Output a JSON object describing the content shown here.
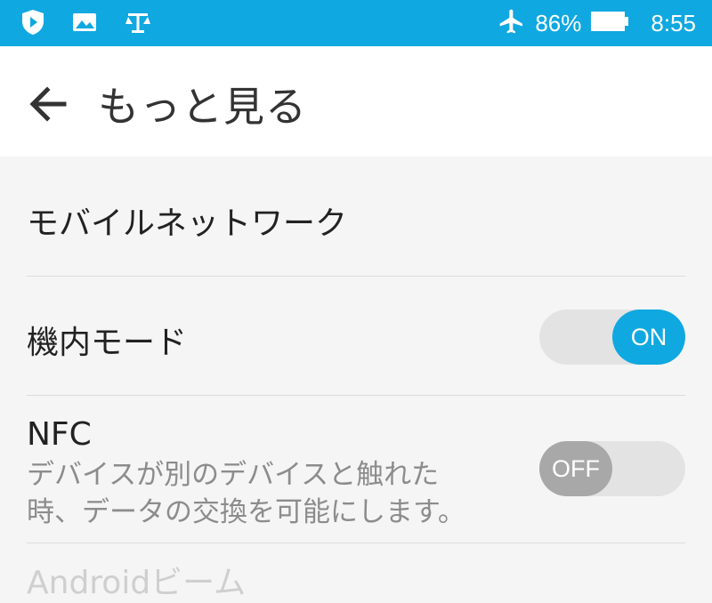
{
  "status_bar": {
    "battery_percent": "86%",
    "time": "8:55",
    "icons": [
      "play-shield-icon",
      "image-icon",
      "scale-icon",
      "airplane-icon",
      "battery-icon"
    ]
  },
  "header": {
    "title": "もっと見る"
  },
  "items": [
    {
      "title": "モバイルネットワーク"
    },
    {
      "title": "機内モード",
      "toggle": "ON"
    },
    {
      "title": "NFC",
      "subtitle_line1": "デバイスが別のデバイスと触れた",
      "subtitle_line2": "時、データの交換を可能にします。",
      "toggle": "OFF"
    },
    {
      "title": "Androidビーム"
    }
  ],
  "colors": {
    "accent": "#10a8e0",
    "toggle_off": "#a8a8a8",
    "track": "#e3e3e3"
  }
}
